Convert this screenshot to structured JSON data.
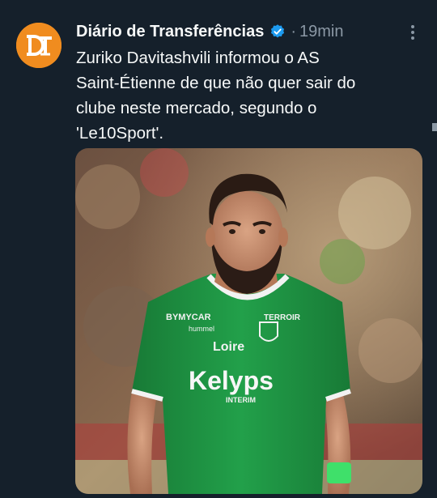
{
  "tweet": {
    "author": {
      "name": "Diário de Transferências",
      "avatar_initials": "DT",
      "avatar_color": "#f08c1f",
      "verified_color": "#1d9bf0"
    },
    "separator": "·",
    "timestamp": "19min",
    "more_icon": "more-vertical-icon",
    "text_lines": [
      "Zuriko Davitashvili informou o AS",
      "Saint-Étienne de que não quer sair do",
      "clube neste mercado, segundo o",
      "'Le10Sport'."
    ],
    "photo": {
      "jersey_color": "#1f9a45",
      "shirt_sponsor": "Kelyps",
      "shirt_sponsor_sub": "INTERIM",
      "shirt_sleeve_sponsor": "Loire",
      "shirt_brand": "hummel",
      "shirt_left_logo": "BYMYCAR",
      "shirt_club_text": "TERROIR"
    }
  },
  "theme": {
    "background": "#15202b",
    "text": "#f7f9f9",
    "muted": "#8b98a5"
  }
}
